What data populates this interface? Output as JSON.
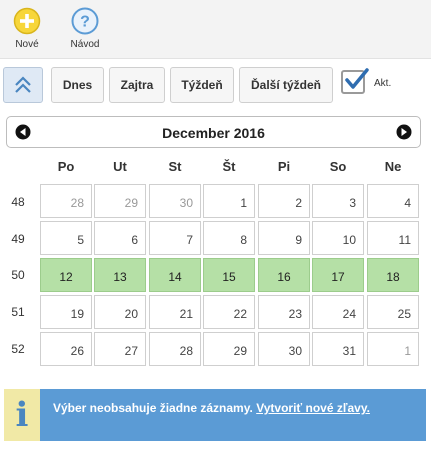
{
  "toolbar": {
    "new_label": "Nové",
    "help_label": "Návod",
    "help_glyph": "?",
    "colors": {
      "new_icon": "#f7d63a",
      "help_icon": "#5b9bd5"
    }
  },
  "nav": {
    "today": "Dnes",
    "tomorrow": "Zajtra",
    "week": "Týždeň",
    "next_week": "Ďalší týždeň",
    "actual_label": "Akt.",
    "actual_checked": true
  },
  "calendar": {
    "month_title": "December 2016",
    "weekdays": [
      "Po",
      "Ut",
      "St",
      "Št",
      "Pi",
      "So",
      "Ne"
    ],
    "weeks": [
      {
        "number": "48",
        "days": [
          {
            "label": "28",
            "other_month": true
          },
          {
            "label": "29",
            "other_month": true
          },
          {
            "label": "30",
            "other_month": true
          },
          {
            "label": "1"
          },
          {
            "label": "2"
          },
          {
            "label": "3"
          },
          {
            "label": "4"
          }
        ]
      },
      {
        "number": "49",
        "days": [
          {
            "label": "5"
          },
          {
            "label": "6"
          },
          {
            "label": "7"
          },
          {
            "label": "8"
          },
          {
            "label": "9"
          },
          {
            "label": "10"
          },
          {
            "label": "11"
          }
        ]
      },
      {
        "number": "50",
        "current_week": true,
        "days": [
          {
            "label": "12"
          },
          {
            "label": "13"
          },
          {
            "label": "14"
          },
          {
            "label": "15"
          },
          {
            "label": "16"
          },
          {
            "label": "17"
          },
          {
            "label": "18"
          }
        ]
      },
      {
        "number": "51",
        "days": [
          {
            "label": "19"
          },
          {
            "label": "20"
          },
          {
            "label": "21"
          },
          {
            "label": "22"
          },
          {
            "label": "23"
          },
          {
            "label": "24"
          },
          {
            "label": "25"
          }
        ]
      },
      {
        "number": "52",
        "days": [
          {
            "label": "26"
          },
          {
            "label": "27"
          },
          {
            "label": "28"
          },
          {
            "label": "29"
          },
          {
            "label": "30"
          },
          {
            "label": "31"
          },
          {
            "label": "1",
            "other_month": true
          }
        ]
      }
    ],
    "colors": {
      "current_week": "#b5e0a6",
      "accent": "#5b9bd5"
    }
  },
  "info": {
    "glyph": "i",
    "message": "Výber neobsahuje žiadne záznamy.",
    "link": "Vytvoriť nové zľavy."
  }
}
